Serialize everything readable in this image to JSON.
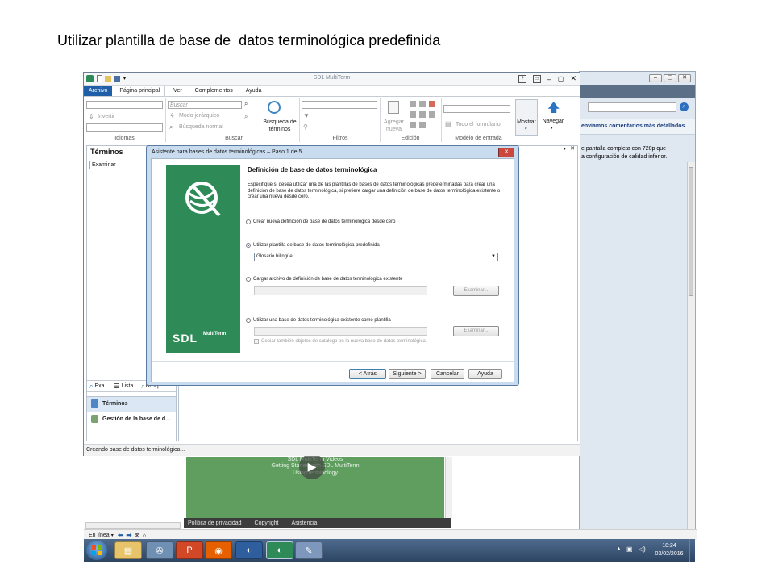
{
  "slide": {
    "title": "Utilizar plantilla de base de  datos terminológica predefinida"
  },
  "app": {
    "title": "SDL MultiTerm",
    "menu_tabs": [
      "Archivo",
      "Página principal",
      "Ver",
      "Complementos",
      "Ayuda"
    ],
    "ribbon": {
      "idiomas": {
        "invert_label": "Invertir",
        "group_label": "Idiomas"
      },
      "buscar": {
        "search_placeholder": "Buscar",
        "hierarchical_label": "Modo jerárquico",
        "normal_search_label": "Búsqueda normal",
        "term_search_label_1": "Búsqueda de",
        "term_search_label_2": "términos",
        "group_label": "Buscar"
      },
      "filtros": {
        "group_label": "Filtros"
      },
      "edicion": {
        "add_label_1": "Agregar",
        "add_label_2": "nueva",
        "group_label": "Edición"
      },
      "modelo": {
        "all_form_label": "Todo el formulario",
        "group_label": "Modelo de entrada"
      },
      "mostrar_label": "Mostrar",
      "navegar_label": "Navegar"
    },
    "left_panel": {
      "title": "Términos",
      "browse_field": "Examinar",
      "bottom_tabs": [
        "Exa...",
        "Lista...",
        "Búsq..."
      ],
      "nav": [
        "Términos",
        "Gestión de la base de d..."
      ]
    },
    "status_text": "Creando base de datos terminológica..."
  },
  "browser": {
    "notice_1": "enviamos comentarios más detallados.",
    "notice_2": "e pantalla completa con 720p que",
    "notice_3": "a configuración de calidad inferior.",
    "video_line_1": "SDL MultiTerm Videos",
    "video_line_2": "Getting Started with SDL MultiTerm",
    "video_line_3": "Using terminology",
    "footer_links": [
      "Política de privacidad",
      "Copyright",
      "Asistencia"
    ],
    "online_label": "En línea"
  },
  "wizard": {
    "title": "Asistente para bases de datos terminológicas – Paso 1 de 5",
    "heading": "Definición de base de datos terminológica",
    "description": "Especifique si desea utilizar una de las plantillas de bases de datos terminológicas predeterminadas para crear una definición de base de datos terminológica, si prefiere cargar una definición de base de datos terminológica existente o crear una nueva desde cero.",
    "options": {
      "create_new": "Crear nueva definición de base de datos terminológica desde cero",
      "use_template": "Utilizar plantilla de base de datos terminológica predefinida",
      "template_value": "Glosario bilingüe",
      "load_file": "Cargar archivo de definición de base de datos terminológica existente",
      "use_existing": "Utilizar una base de datos terminológica existente como plantilla",
      "copy_catalog": "Copiar también objetos de catálogo en la nueva base de datos terminológica"
    },
    "browse_label": "Examinar...",
    "buttons": {
      "back": "< Atrás",
      "next": "Siguiente >",
      "cancel": "Cancelar",
      "help": "Ayuda"
    },
    "logo_text": "SDL",
    "logo_sub": "MultiTerm",
    "selected": "use_template"
  },
  "taskbar": {
    "clock_time": "18:24",
    "clock_date": "03/02/2016"
  },
  "colors": {
    "accent_blue": "#1e5fa8",
    "sdl_green": "#2e8b57",
    "video_green": "#5f9e5f",
    "dialog_title": "#c9dbef"
  }
}
